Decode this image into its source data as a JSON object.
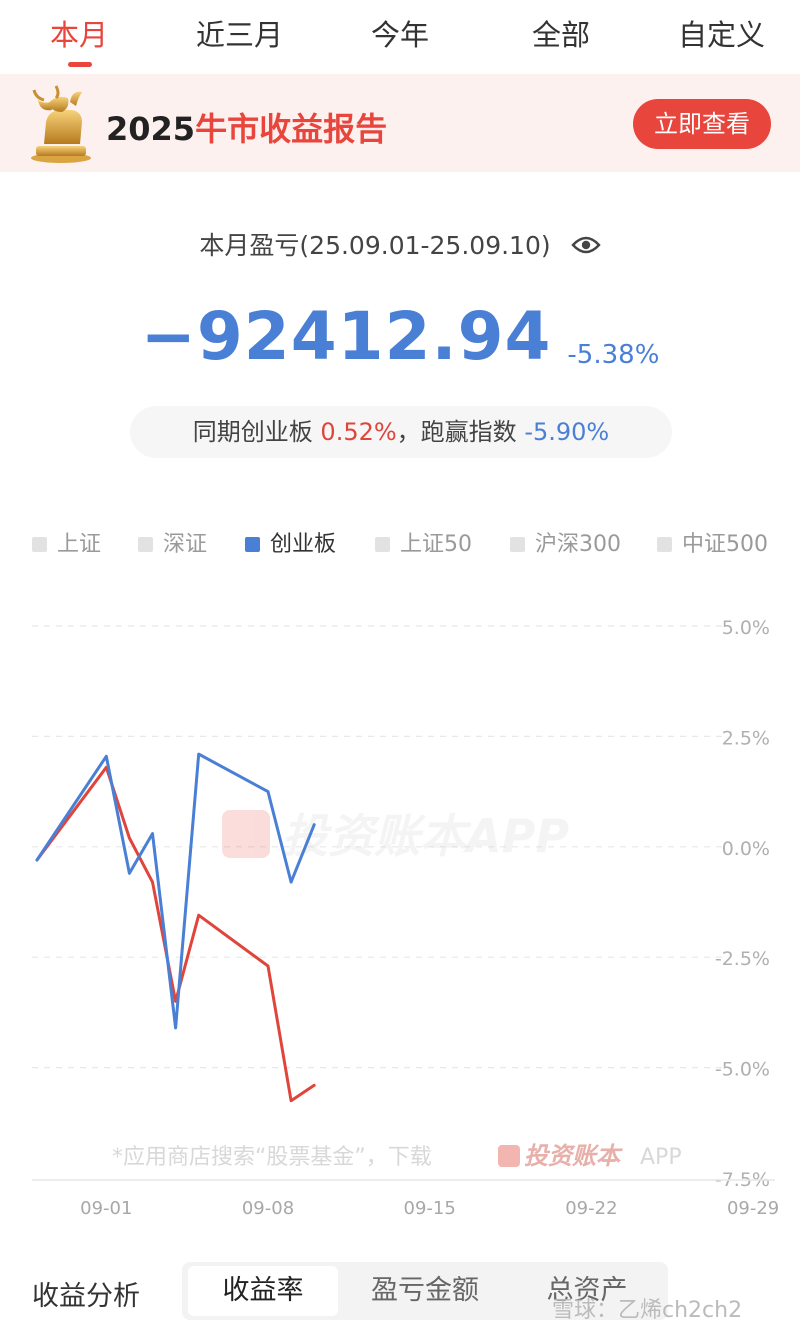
{
  "tabs": [
    "本月",
    "近三月",
    "今年",
    "全部",
    "自定义"
  ],
  "banner": {
    "year": "2025",
    "title": "牛市收益报告",
    "button": "立即查看"
  },
  "summary": {
    "period_label": "本月盈亏(25.09.01-25.09.10)",
    "amount": "−92412.94",
    "percent": "-5.38%",
    "compare_prefix": "同期创业板",
    "compare_index_pct": "0.52%",
    "compare_mid": "，跑赢指数",
    "compare_beat_pct": "-5.90%"
  },
  "legend": [
    {
      "label": "上证",
      "active": false
    },
    {
      "label": "深证",
      "active": false
    },
    {
      "label": "创业板",
      "active": true
    },
    {
      "label": "上证50",
      "active": false
    },
    {
      "label": "沪深300",
      "active": false
    },
    {
      "label": "中证500",
      "active": false
    }
  ],
  "chart_data": {
    "type": "line",
    "x_ticks": [
      "09-01",
      "09-08",
      "09-15",
      "09-22",
      "09-29"
    ],
    "y_ticks": [
      "5.0%",
      "2.5%",
      "0.0%",
      "-2.5%",
      "-5.0%",
      "-7.5%"
    ],
    "ylim": [
      -7.5,
      5.0
    ],
    "xlim": [
      "08-29",
      "09-29"
    ],
    "grid": true,
    "series": [
      {
        "name": "创业板",
        "color": "#4a7fd6",
        "points": [
          {
            "x": "08-29",
            "y": -0.3
          },
          {
            "x": "09-01",
            "y": 2.05
          },
          {
            "x": "09-02",
            "y": -0.6
          },
          {
            "x": "09-03",
            "y": 0.3
          },
          {
            "x": "09-04",
            "y": -4.1
          },
          {
            "x": "09-05",
            "y": 2.1
          },
          {
            "x": "09-08",
            "y": 1.25
          },
          {
            "x": "09-09",
            "y": -0.8
          },
          {
            "x": "09-10",
            "y": 0.5
          }
        ]
      },
      {
        "color": "#e0453c",
        "points": [
          {
            "x": "08-29",
            "y": -0.3
          },
          {
            "x": "09-01",
            "y": 1.8
          },
          {
            "x": "09-02",
            "y": 0.2
          },
          {
            "x": "09-03",
            "y": -0.8
          },
          {
            "x": "09-04",
            "y": -3.5
          },
          {
            "x": "09-05",
            "y": -1.55
          },
          {
            "x": "09-08",
            "y": -2.7
          },
          {
            "x": "09-09",
            "y": -5.75
          },
          {
            "x": "09-10",
            "y": -5.4
          }
        ]
      }
    ]
  },
  "watermark": {
    "brand": "投资账本APP",
    "promo": "*应用商店搜索“股票基金”，下载",
    "promo_brand": "投资账本",
    "promo_suffix": "APP"
  },
  "bottom": {
    "title": "收益分析",
    "segments": [
      "收益率",
      "盈亏金额",
      "总资产"
    ],
    "active_segment": 0
  },
  "overlay_watermark": "雪球：乙烯ch2ch2",
  "colors": {
    "accent": "#e8453c",
    "negative": "#4a7fd6",
    "positive": "#e0453c"
  }
}
